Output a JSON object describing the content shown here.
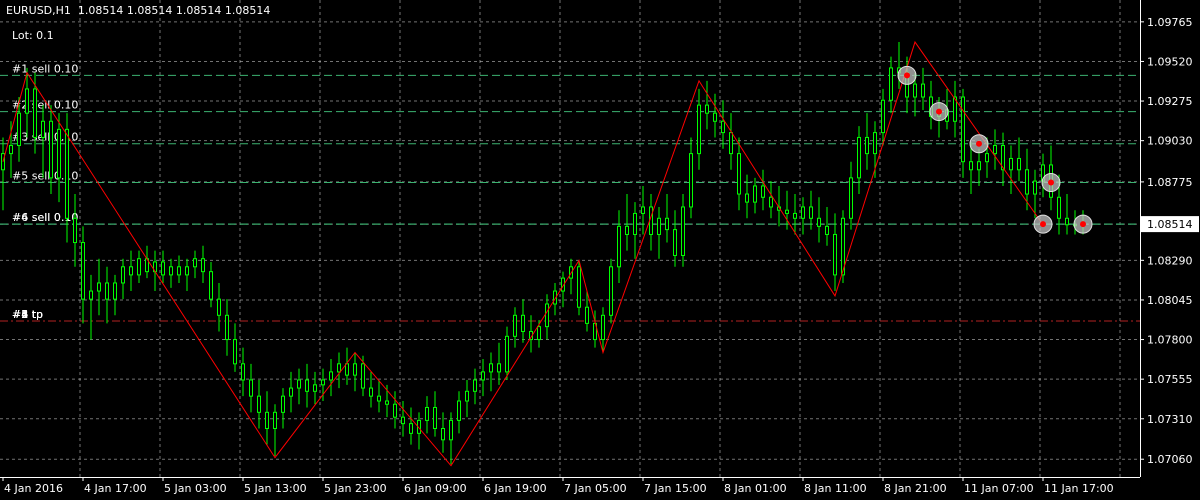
{
  "header": {
    "symbol_line": "EURUSD,H1  1.08514 1.08514 1.08514 1.08514",
    "lot": "Lot: 0.1"
  },
  "colors": {
    "background": "#000000",
    "grid": "#ffffff",
    "bars": "#00ff00",
    "zigzag": "#ff0000",
    "order_line": "#3cb371",
    "tp_line": "#b22222",
    "marker_fill": "#c0c0c0",
    "marker_dot": "#ff0000"
  },
  "chart_data": {
    "type": "candlestick",
    "symbol": "EURUSD",
    "timeframe": "H1",
    "ylim": [
      1.0695,
      1.099
    ],
    "y_ticks": [
      1.0706,
      1.0731,
      1.07555,
      1.078,
      1.08045,
      1.0829,
      1.08514,
      1.08775,
      1.0903,
      1.09275,
      1.0952,
      1.09765
    ],
    "current_price": "1.08514",
    "x_ticks": [
      "4 Jan 2016",
      "4 Jan 17:00",
      "5 Jan 03:00",
      "5 Jan 13:00",
      "5 Jan 23:00",
      "6 Jan 09:00",
      "6 Jan 19:00",
      "7 Jan 05:00",
      "7 Jan 15:00",
      "8 Jan 01:00",
      "8 Jan 11:00",
      "8 Jan 21:00",
      "11 Jan 07:00",
      "11 Jan 17:00"
    ],
    "x_ticks_bar_index": [
      0,
      10,
      20,
      30,
      40,
      50,
      60,
      70,
      80,
      90,
      100,
      110,
      120,
      130
    ],
    "bar_count": 136,
    "zigzag": [
      {
        "bar": 0,
        "price": 1.089
      },
      {
        "bar": 3,
        "price": 1.0945
      },
      {
        "bar": 34,
        "price": 1.0707
      },
      {
        "bar": 44,
        "price": 1.0772
      },
      {
        "bar": 56,
        "price": 1.0702
      },
      {
        "bar": 72,
        "price": 1.0829
      },
      {
        "bar": 75,
        "price": 1.0772
      },
      {
        "bar": 87,
        "price": 1.094
      },
      {
        "bar": 104,
        "price": 1.0807
      },
      {
        "bar": 114,
        "price": 1.0964
      },
      {
        "bar": 130,
        "price": 1.0851
      }
    ],
    "order_levels": [
      {
        "label": "#1 sell 0.10",
        "price": 1.09434
      },
      {
        "label": "#2 sell 0.10",
        "price": 1.0921
      },
      {
        "label": "#3 sell 0.10",
        "price": 1.09011
      },
      {
        "label": "#5 sell 0.10",
        "price": 1.08771
      },
      {
        "label": "#6 sell 0.10",
        "price": 1.08514
      },
      {
        "label": "#4 sell 0.10",
        "price": 1.08514
      }
    ],
    "tp_level": {
      "label": "#1 tp",
      "price": 1.07915
    },
    "tp_overlap_labels": [
      "#2 tp",
      "#3 tp",
      "#4 tp",
      "#5 tp",
      "#6 tp"
    ],
    "entry_markers": [
      {
        "bar": 113,
        "price": 1.09434
      },
      {
        "bar": 117,
        "price": 1.0921
      },
      {
        "bar": 122,
        "price": 1.09011
      },
      {
        "bar": 130,
        "price": 1.08514
      },
      {
        "bar": 131,
        "price": 1.08771
      },
      {
        "bar": 135,
        "price": 1.08514
      }
    ],
    "candles": [
      [
        1.0885,
        1.0905,
        1.086,
        1.0895
      ],
      [
        1.0895,
        1.0915,
        1.088,
        1.09
      ],
      [
        1.09,
        1.093,
        1.089,
        1.092
      ],
      [
        1.092,
        1.0948,
        1.0905,
        1.0935
      ],
      [
        1.0935,
        1.0945,
        1.0895,
        1.0905
      ],
      [
        1.0905,
        1.0925,
        1.088,
        1.0915
      ],
      [
        1.0915,
        1.0925,
        1.087,
        1.088
      ],
      [
        1.088,
        1.092,
        1.0865,
        1.091
      ],
      [
        1.091,
        1.092,
        1.084,
        1.0855
      ],
      [
        1.0855,
        1.087,
        1.0825,
        1.084
      ],
      [
        1.084,
        1.085,
        1.079,
        1.0805
      ],
      [
        1.0805,
        1.082,
        1.078,
        1.081
      ],
      [
        1.081,
        1.083,
        1.0795,
        1.0815
      ],
      [
        1.0815,
        1.0825,
        1.079,
        1.0805
      ],
      [
        1.0805,
        1.082,
        1.0795,
        1.0815
      ],
      [
        1.0815,
        1.083,
        1.0805,
        1.0825
      ],
      [
        1.0825,
        1.0835,
        1.081,
        1.082
      ],
      [
        1.082,
        1.0835,
        1.0815,
        1.083
      ],
      [
        1.083,
        1.0838,
        1.0818,
        1.0822
      ],
      [
        1.0822,
        1.0835,
        1.081,
        1.0828
      ],
      [
        1.0828,
        1.0835,
        1.0815,
        1.082
      ],
      [
        1.082,
        1.083,
        1.0812,
        1.0825
      ],
      [
        1.0825,
        1.0832,
        1.0815,
        1.082
      ],
      [
        1.082,
        1.083,
        1.081,
        1.0825
      ],
      [
        1.0825,
        1.0835,
        1.0818,
        1.083
      ],
      [
        1.083,
        1.0838,
        1.0815,
        1.0822
      ],
      [
        1.0822,
        1.0828,
        1.08,
        1.0805
      ],
      [
        1.0805,
        1.0815,
        1.0785,
        1.0795
      ],
      [
        1.0795,
        1.0805,
        1.077,
        1.078
      ],
      [
        1.078,
        1.079,
        1.076,
        1.0765
      ],
      [
        1.0765,
        1.0775,
        1.0745,
        1.0755
      ],
      [
        1.0755,
        1.0765,
        1.0735,
        1.0745
      ],
      [
        1.0745,
        1.0755,
        1.0725,
        1.0735
      ],
      [
        1.0735,
        1.0748,
        1.0715,
        1.0725
      ],
      [
        1.0725,
        1.074,
        1.0708,
        1.0735
      ],
      [
        1.0735,
        1.075,
        1.0725,
        1.0745
      ],
      [
        1.0745,
        1.076,
        1.0735,
        1.075
      ],
      [
        1.075,
        1.0762,
        1.074,
        1.0755
      ],
      [
        1.0755,
        1.0765,
        1.0738,
        1.0748
      ],
      [
        1.0748,
        1.076,
        1.074,
        1.0752
      ],
      [
        1.0752,
        1.0762,
        1.0742,
        1.0755
      ],
      [
        1.0755,
        1.0768,
        1.0745,
        1.076
      ],
      [
        1.076,
        1.0772,
        1.075,
        1.0765
      ],
      [
        1.0765,
        1.0775,
        1.0752,
        1.0758
      ],
      [
        1.0758,
        1.0772,
        1.0748,
        1.0765
      ],
      [
        1.0765,
        1.077,
        1.0745,
        1.075
      ],
      [
        1.075,
        1.076,
        1.0738,
        1.0745
      ],
      [
        1.0745,
        1.0755,
        1.0735,
        1.0742
      ],
      [
        1.0742,
        1.0752,
        1.0732,
        1.074
      ],
      [
        1.074,
        1.0748,
        1.0725,
        1.0732
      ],
      [
        1.0732,
        1.0742,
        1.072,
        1.0728
      ],
      [
        1.0728,
        1.0738,
        1.0715,
        1.0722
      ],
      [
        1.0722,
        1.0735,
        1.0712,
        1.073
      ],
      [
        1.073,
        1.0745,
        1.0722,
        1.0738
      ],
      [
        1.0738,
        1.0748,
        1.072,
        1.0725
      ],
      [
        1.0725,
        1.0735,
        1.071,
        1.0718
      ],
      [
        1.0718,
        1.0735,
        1.0703,
        1.073
      ],
      [
        1.073,
        1.0748,
        1.0722,
        1.0742
      ],
      [
        1.0742,
        1.0755,
        1.0732,
        1.0748
      ],
      [
        1.0748,
        1.0762,
        1.074,
        1.0755
      ],
      [
        1.0755,
        1.0768,
        1.0745,
        1.076
      ],
      [
        1.076,
        1.0772,
        1.0748,
        1.0765
      ],
      [
        1.0765,
        1.0778,
        1.0752,
        1.076
      ],
      [
        1.076,
        1.0788,
        1.0755,
        1.0782
      ],
      [
        1.0782,
        1.08,
        1.0775,
        1.0795
      ],
      [
        1.0795,
        1.0805,
        1.0778,
        1.0785
      ],
      [
        1.0785,
        1.0795,
        1.0772,
        1.078
      ],
      [
        1.078,
        1.0792,
        1.0775,
        1.0788
      ],
      [
        1.0788,
        1.0808,
        1.078,
        1.0802
      ],
      [
        1.0802,
        1.0815,
        1.0795,
        1.081
      ],
      [
        1.081,
        1.0822,
        1.08,
        1.0818
      ],
      [
        1.0818,
        1.083,
        1.0808,
        1.0825
      ],
      [
        1.0825,
        1.0829,
        1.0795,
        1.08
      ],
      [
        1.08,
        1.081,
        1.0785,
        1.079
      ],
      [
        1.079,
        1.0798,
        1.0775,
        1.078
      ],
      [
        1.078,
        1.08,
        1.0772,
        1.0795
      ],
      [
        1.0795,
        1.083,
        1.079,
        1.0825
      ],
      [
        1.0825,
        1.086,
        1.0815,
        1.085
      ],
      [
        1.085,
        1.087,
        1.0835,
        1.0845
      ],
      [
        1.0845,
        1.0865,
        1.083,
        1.0858
      ],
      [
        1.0858,
        1.0875,
        1.0845,
        1.0862
      ],
      [
        1.0862,
        1.087,
        1.0835,
        1.0845
      ],
      [
        1.0845,
        1.0862,
        1.083,
        1.0855
      ],
      [
        1.0855,
        1.087,
        1.084,
        1.0848
      ],
      [
        1.0848,
        1.086,
        1.0825,
        1.0832
      ],
      [
        1.0832,
        1.087,
        1.0825,
        1.0862
      ],
      [
        1.0862,
        1.0905,
        1.0855,
        1.0895
      ],
      [
        1.0895,
        1.0935,
        1.0885,
        1.0925
      ],
      [
        1.0925,
        1.094,
        1.091,
        1.092
      ],
      [
        1.092,
        1.0932,
        1.0905,
        1.0915
      ],
      [
        1.0915,
        1.0928,
        1.0898,
        1.0908
      ],
      [
        1.0908,
        1.092,
        1.0885,
        1.0895
      ],
      [
        1.0895,
        1.0905,
        1.086,
        1.087
      ],
      [
        1.087,
        1.0882,
        1.0855,
        1.0865
      ],
      [
        1.0865,
        1.088,
        1.0858,
        1.0875
      ],
      [
        1.0875,
        1.0885,
        1.086,
        1.0868
      ],
      [
        1.0868,
        1.0878,
        1.0855,
        1.0862
      ],
      [
        1.0862,
        1.0875,
        1.085,
        1.086
      ],
      [
        1.086,
        1.0872,
        1.0848,
        1.0858
      ],
      [
        1.0858,
        1.087,
        1.0845,
        1.0855
      ],
      [
        1.0855,
        1.0868,
        1.0845,
        1.0862
      ],
      [
        1.0862,
        1.0872,
        1.0848,
        1.0855
      ],
      [
        1.0855,
        1.0868,
        1.084,
        1.085
      ],
      [
        1.085,
        1.0862,
        1.0838,
        1.0845
      ],
      [
        1.0845,
        1.0858,
        1.081,
        1.082
      ],
      [
        1.082,
        1.086,
        1.0815,
        1.0855
      ],
      [
        1.0855,
        1.089,
        1.0848,
        1.088
      ],
      [
        1.088,
        1.0912,
        1.087,
        1.0905
      ],
      [
        1.0905,
        1.092,
        1.0885,
        1.0895
      ],
      [
        1.0895,
        1.0915,
        1.088,
        1.0908
      ],
      [
        1.0908,
        1.0935,
        1.09,
        1.0928
      ],
      [
        1.0928,
        1.0955,
        1.092,
        1.0948
      ],
      [
        1.0948,
        1.0964,
        1.0935,
        1.0945
      ],
      [
        1.0945,
        1.0955,
        1.092,
        1.093
      ],
      [
        1.093,
        1.0945,
        1.0918,
        1.0938
      ],
      [
        1.0938,
        1.0948,
        1.0922,
        1.093
      ],
      [
        1.093,
        1.094,
        1.091,
        1.0918
      ],
      [
        1.0918,
        1.093,
        1.0905,
        1.0922
      ],
      [
        1.0922,
        1.0935,
        1.091,
        1.0915
      ],
      [
        1.0915,
        1.094,
        1.0905,
        1.093
      ],
      [
        1.093,
        1.0935,
        1.088,
        1.089
      ],
      [
        1.089,
        1.0902,
        1.087,
        1.0885
      ],
      [
        1.0885,
        1.0898,
        1.0875,
        1.089
      ],
      [
        1.089,
        1.0905,
        1.088,
        1.0895
      ],
      [
        1.0895,
        1.091,
        1.0885,
        1.09
      ],
      [
        1.09,
        1.0908,
        1.0875,
        1.0885
      ],
      [
        1.0885,
        1.09,
        1.087,
        1.0892
      ],
      [
        1.0892,
        1.0905,
        1.0878,
        1.0885
      ],
      [
        1.0885,
        1.0898,
        1.086,
        1.087
      ],
      [
        1.087,
        1.0885,
        1.0855,
        1.0878
      ],
      [
        1.0878,
        1.0895,
        1.0868,
        1.0888
      ],
      [
        1.0888,
        1.09,
        1.086,
        1.0868
      ],
      [
        1.0868,
        1.0882,
        1.0845,
        1.0855
      ],
      [
        1.0855,
        1.087,
        1.0845,
        1.0851
      ],
      [
        1.0851,
        1.086,
        1.0845,
        1.0851
      ],
      [
        1.0851,
        1.086,
        1.0845,
        1.0851
      ]
    ]
  }
}
